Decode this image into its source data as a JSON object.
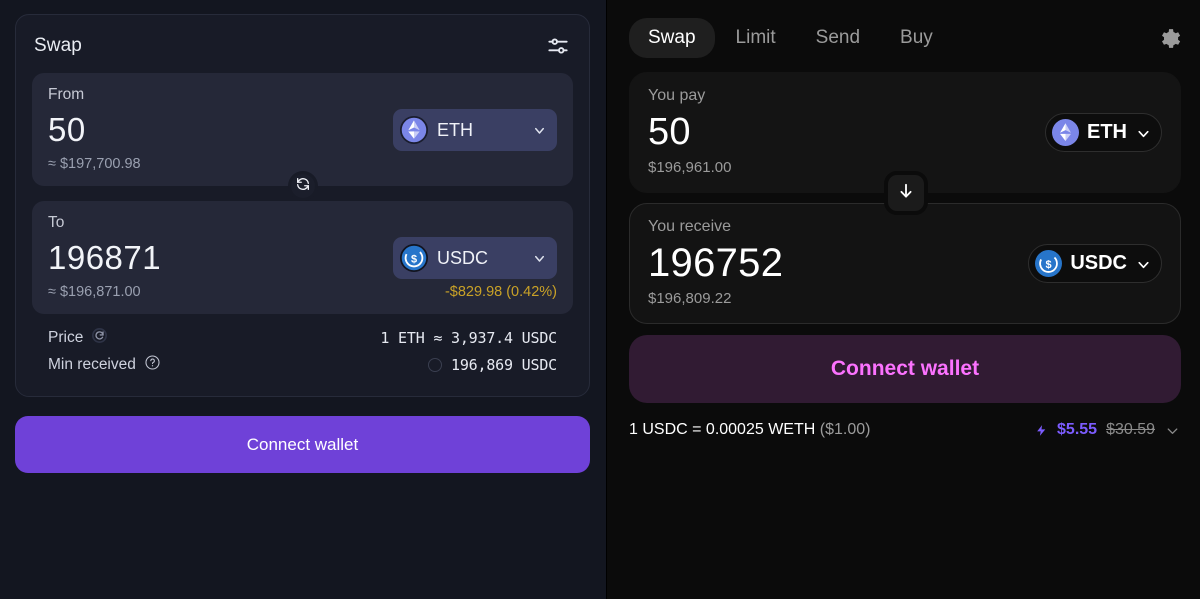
{
  "left": {
    "title": "Swap",
    "settings_icon": "tune-sliders-icon",
    "from": {
      "label": "From",
      "amount": "50",
      "usd": "≈ $197,700.98",
      "token": "ETH",
      "token_icon": "ethereum-icon"
    },
    "swap_toggle_icon": "refresh-swap-icon",
    "to": {
      "label": "To",
      "amount": "196871",
      "usd": "≈ $196,871.00",
      "diff": "-$829.98 (0.42%)",
      "diff_color": "#c9a227",
      "token": "USDC",
      "token_icon": "usdc-icon"
    },
    "details": [
      {
        "key": "Price",
        "key_icon": "refresh-icon",
        "value": "1 ETH ≈ 3,937.4 USDC"
      },
      {
        "key": "Min received",
        "key_icon": "help-circle-icon",
        "value": "196,869 USDC"
      }
    ],
    "connect_label": "Connect wallet",
    "connect_color": "#6f41d8"
  },
  "right": {
    "tabs": [
      {
        "label": "Swap",
        "active": true
      },
      {
        "label": "Limit",
        "active": false
      },
      {
        "label": "Send",
        "active": false
      },
      {
        "label": "Buy",
        "active": false
      }
    ],
    "settings_icon": "gear-icon",
    "pay": {
      "label": "You pay",
      "amount": "50",
      "usd": "$196,961.00",
      "token": "ETH",
      "token_icon": "ethereum-icon"
    },
    "swap_toggle_icon": "arrow-down-icon",
    "receive": {
      "label": "You receive",
      "amount": "196752",
      "usd": "$196,809.22",
      "token": "USDC",
      "token_icon": "usdc-icon"
    },
    "connect_label": "Connect wallet",
    "connect_color": "#fc72ff",
    "rate": {
      "text": "1 USDC = 0.00025 WETH",
      "paren": "($1.00)",
      "gas_icon": "lightning-bolt-icon",
      "gas_new": "$5.55",
      "gas_old": "$30.59",
      "expand_icon": "chevron-down-icon"
    }
  }
}
